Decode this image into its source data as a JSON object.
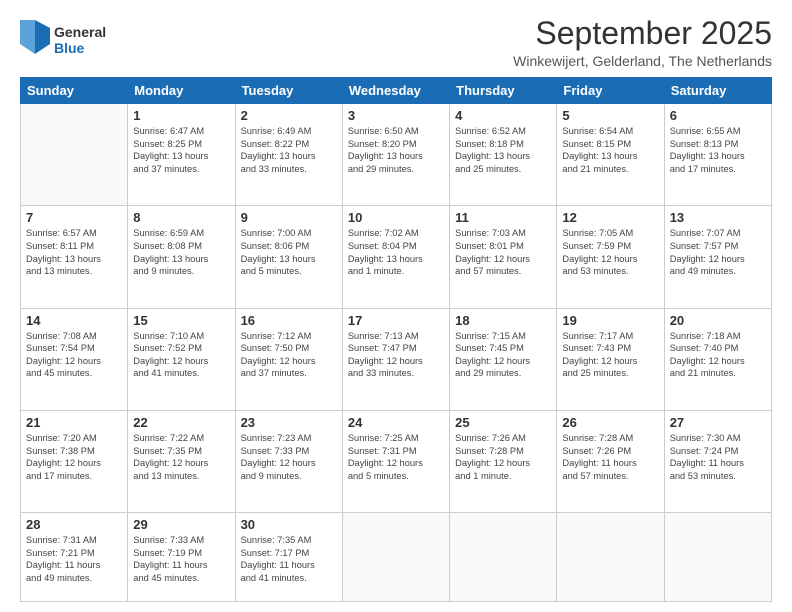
{
  "header": {
    "logo_line1": "General",
    "logo_line2": "Blue",
    "month": "September 2025",
    "location": "Winkewijert, Gelderland, The Netherlands"
  },
  "weekdays": [
    "Sunday",
    "Monday",
    "Tuesday",
    "Wednesday",
    "Thursday",
    "Friday",
    "Saturday"
  ],
  "weeks": [
    [
      {
        "day": "",
        "info": ""
      },
      {
        "day": "1",
        "info": "Sunrise: 6:47 AM\nSunset: 8:25 PM\nDaylight: 13 hours\nand 37 minutes."
      },
      {
        "day": "2",
        "info": "Sunrise: 6:49 AM\nSunset: 8:22 PM\nDaylight: 13 hours\nand 33 minutes."
      },
      {
        "day": "3",
        "info": "Sunrise: 6:50 AM\nSunset: 8:20 PM\nDaylight: 13 hours\nand 29 minutes."
      },
      {
        "day": "4",
        "info": "Sunrise: 6:52 AM\nSunset: 8:18 PM\nDaylight: 13 hours\nand 25 minutes."
      },
      {
        "day": "5",
        "info": "Sunrise: 6:54 AM\nSunset: 8:15 PM\nDaylight: 13 hours\nand 21 minutes."
      },
      {
        "day": "6",
        "info": "Sunrise: 6:55 AM\nSunset: 8:13 PM\nDaylight: 13 hours\nand 17 minutes."
      }
    ],
    [
      {
        "day": "7",
        "info": "Sunrise: 6:57 AM\nSunset: 8:11 PM\nDaylight: 13 hours\nand 13 minutes."
      },
      {
        "day": "8",
        "info": "Sunrise: 6:59 AM\nSunset: 8:08 PM\nDaylight: 13 hours\nand 9 minutes."
      },
      {
        "day": "9",
        "info": "Sunrise: 7:00 AM\nSunset: 8:06 PM\nDaylight: 13 hours\nand 5 minutes."
      },
      {
        "day": "10",
        "info": "Sunrise: 7:02 AM\nSunset: 8:04 PM\nDaylight: 13 hours\nand 1 minute."
      },
      {
        "day": "11",
        "info": "Sunrise: 7:03 AM\nSunset: 8:01 PM\nDaylight: 12 hours\nand 57 minutes."
      },
      {
        "day": "12",
        "info": "Sunrise: 7:05 AM\nSunset: 7:59 PM\nDaylight: 12 hours\nand 53 minutes."
      },
      {
        "day": "13",
        "info": "Sunrise: 7:07 AM\nSunset: 7:57 PM\nDaylight: 12 hours\nand 49 minutes."
      }
    ],
    [
      {
        "day": "14",
        "info": "Sunrise: 7:08 AM\nSunset: 7:54 PM\nDaylight: 12 hours\nand 45 minutes."
      },
      {
        "day": "15",
        "info": "Sunrise: 7:10 AM\nSunset: 7:52 PM\nDaylight: 12 hours\nand 41 minutes."
      },
      {
        "day": "16",
        "info": "Sunrise: 7:12 AM\nSunset: 7:50 PM\nDaylight: 12 hours\nand 37 minutes."
      },
      {
        "day": "17",
        "info": "Sunrise: 7:13 AM\nSunset: 7:47 PM\nDaylight: 12 hours\nand 33 minutes."
      },
      {
        "day": "18",
        "info": "Sunrise: 7:15 AM\nSunset: 7:45 PM\nDaylight: 12 hours\nand 29 minutes."
      },
      {
        "day": "19",
        "info": "Sunrise: 7:17 AM\nSunset: 7:43 PM\nDaylight: 12 hours\nand 25 minutes."
      },
      {
        "day": "20",
        "info": "Sunrise: 7:18 AM\nSunset: 7:40 PM\nDaylight: 12 hours\nand 21 minutes."
      }
    ],
    [
      {
        "day": "21",
        "info": "Sunrise: 7:20 AM\nSunset: 7:38 PM\nDaylight: 12 hours\nand 17 minutes."
      },
      {
        "day": "22",
        "info": "Sunrise: 7:22 AM\nSunset: 7:35 PM\nDaylight: 12 hours\nand 13 minutes."
      },
      {
        "day": "23",
        "info": "Sunrise: 7:23 AM\nSunset: 7:33 PM\nDaylight: 12 hours\nand 9 minutes."
      },
      {
        "day": "24",
        "info": "Sunrise: 7:25 AM\nSunset: 7:31 PM\nDaylight: 12 hours\nand 5 minutes."
      },
      {
        "day": "25",
        "info": "Sunrise: 7:26 AM\nSunset: 7:28 PM\nDaylight: 12 hours\nand 1 minute."
      },
      {
        "day": "26",
        "info": "Sunrise: 7:28 AM\nSunset: 7:26 PM\nDaylight: 11 hours\nand 57 minutes."
      },
      {
        "day": "27",
        "info": "Sunrise: 7:30 AM\nSunset: 7:24 PM\nDaylight: 11 hours\nand 53 minutes."
      }
    ],
    [
      {
        "day": "28",
        "info": "Sunrise: 7:31 AM\nSunset: 7:21 PM\nDaylight: 11 hours\nand 49 minutes."
      },
      {
        "day": "29",
        "info": "Sunrise: 7:33 AM\nSunset: 7:19 PM\nDaylight: 11 hours\nand 45 minutes."
      },
      {
        "day": "30",
        "info": "Sunrise: 7:35 AM\nSunset: 7:17 PM\nDaylight: 11 hours\nand 41 minutes."
      },
      {
        "day": "",
        "info": ""
      },
      {
        "day": "",
        "info": ""
      },
      {
        "day": "",
        "info": ""
      },
      {
        "day": "",
        "info": ""
      }
    ]
  ]
}
